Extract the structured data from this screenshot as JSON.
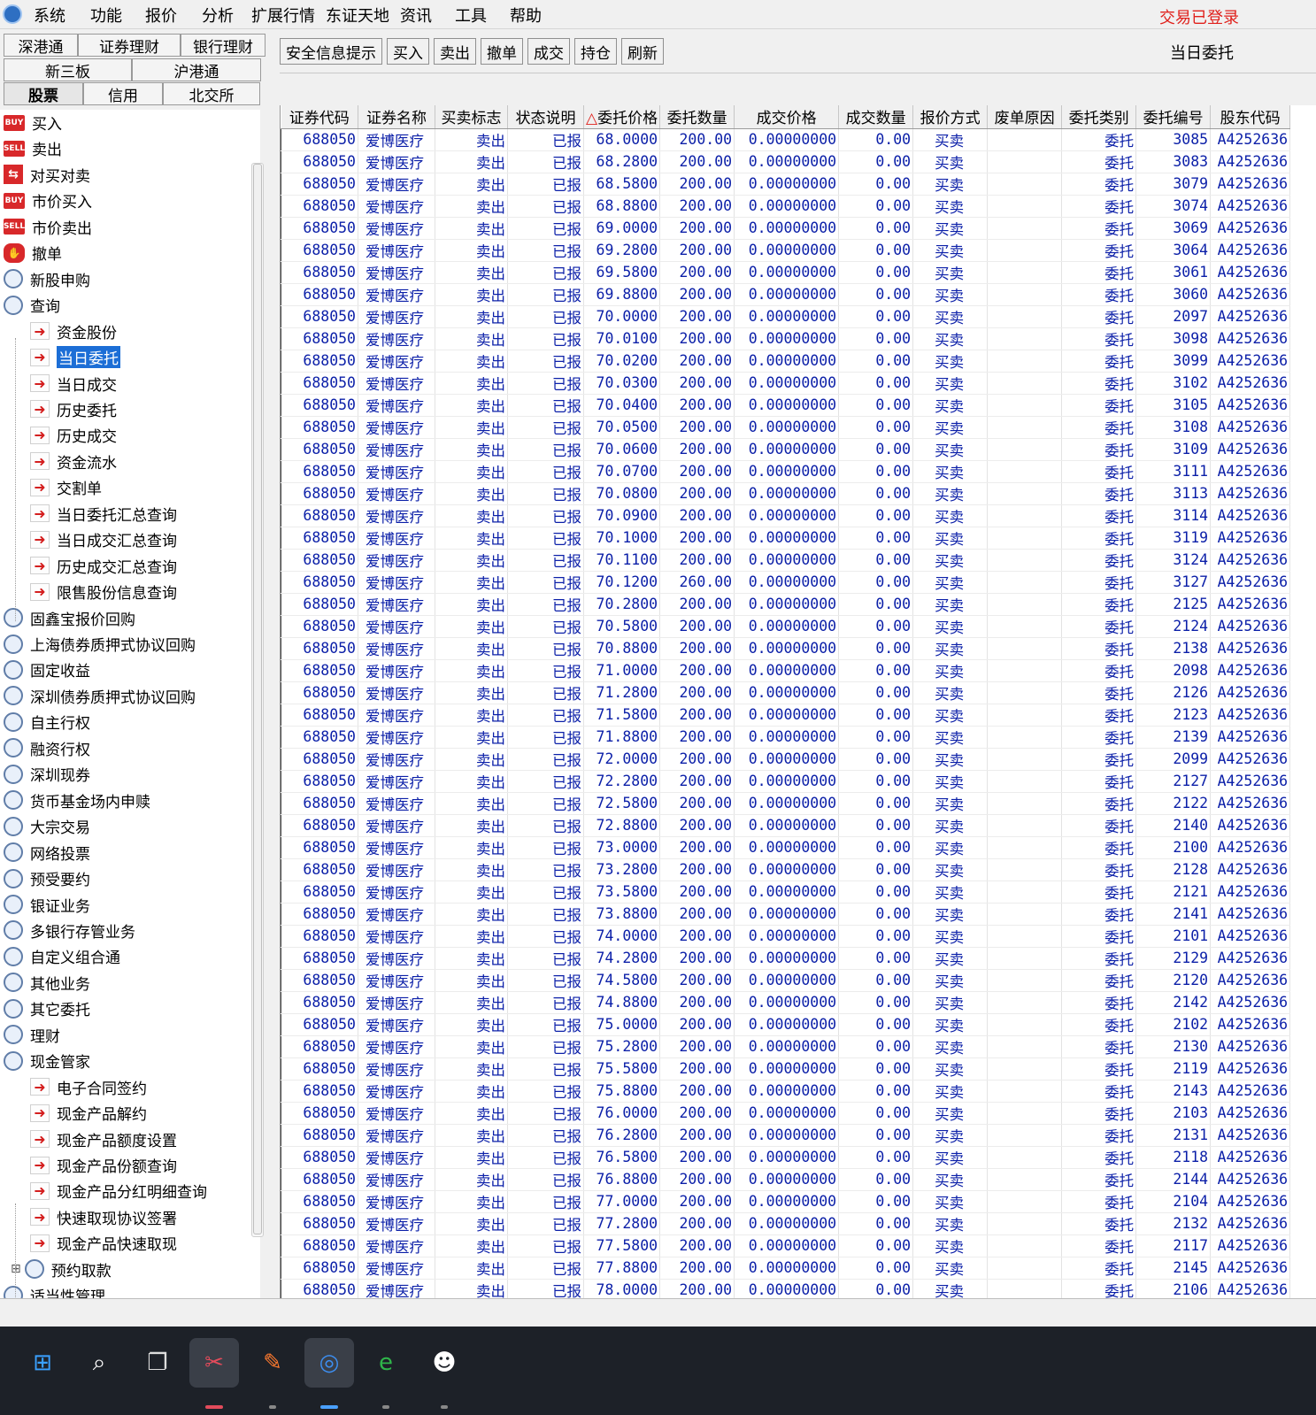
{
  "menubar": {
    "items": [
      "系统",
      "功能",
      "报价",
      "分析",
      "扩展行情",
      "东证天地",
      "资讯",
      "工具",
      "帮助"
    ],
    "login_status": "交易已登录"
  },
  "tabs": {
    "row1": [
      "深港通",
      "证券理财",
      "银行理财"
    ],
    "row2": [
      "新三板",
      "沪港通"
    ],
    "row3": [
      "股票",
      "信用",
      "北交所"
    ]
  },
  "tree": {
    "items": [
      {
        "label": "买入",
        "icon": "buy-icon",
        "level": 0
      },
      {
        "label": "卖出",
        "icon": "sell-icon",
        "level": 0
      },
      {
        "label": "对买对卖",
        "icon": "swap-icon",
        "level": 0
      },
      {
        "label": "市价买入",
        "icon": "buy-icon",
        "level": 0
      },
      {
        "label": "市价卖出",
        "icon": "sell-icon",
        "level": 0
      },
      {
        "label": "撤单",
        "icon": "hand-icon",
        "level": 0
      },
      {
        "label": "新股申购",
        "icon": "magnifier-icon",
        "level": 0
      },
      {
        "label": "查询",
        "icon": "magnifier-icon",
        "level": 0
      },
      {
        "label": "资金股份",
        "icon": "arrow-icon",
        "level": 1
      },
      {
        "label": "当日委托",
        "icon": "arrow-icon",
        "level": 1,
        "selected": true
      },
      {
        "label": "当日成交",
        "icon": "arrow-icon",
        "level": 1
      },
      {
        "label": "历史委托",
        "icon": "arrow-icon",
        "level": 1
      },
      {
        "label": "历史成交",
        "icon": "arrow-icon",
        "level": 1
      },
      {
        "label": "资金流水",
        "icon": "arrow-icon",
        "level": 1
      },
      {
        "label": "交割单",
        "icon": "arrow-icon",
        "level": 1
      },
      {
        "label": "当日委托汇总查询",
        "icon": "arrow-icon",
        "level": 1
      },
      {
        "label": "当日成交汇总查询",
        "icon": "arrow-icon",
        "level": 1
      },
      {
        "label": "历史成交汇总查询",
        "icon": "arrow-icon",
        "level": 1
      },
      {
        "label": "限售股份信息查询",
        "icon": "arrow-icon",
        "level": 1
      },
      {
        "label": "固鑫宝报价回购",
        "icon": "magnifier-icon",
        "level": 0
      },
      {
        "label": "上海债券质押式协议回购",
        "icon": "magnifier-icon",
        "level": 0
      },
      {
        "label": "固定收益",
        "icon": "magnifier-icon",
        "level": 0
      },
      {
        "label": "深圳债券质押式协议回购",
        "icon": "magnifier-icon",
        "level": 0
      },
      {
        "label": "自主行权",
        "icon": "magnifier-icon",
        "level": 0
      },
      {
        "label": "融资行权",
        "icon": "magnifier-icon",
        "level": 0
      },
      {
        "label": "深圳现券",
        "icon": "magnifier-icon",
        "level": 0
      },
      {
        "label": "货币基金场内申赎",
        "icon": "magnifier-icon",
        "level": 0
      },
      {
        "label": "大宗交易",
        "icon": "magnifier-icon",
        "level": 0
      },
      {
        "label": "网络投票",
        "icon": "magnifier-icon",
        "level": 0
      },
      {
        "label": "预受要约",
        "icon": "magnifier-icon",
        "level": 0
      },
      {
        "label": "银证业务",
        "icon": "magnifier-icon",
        "level": 0
      },
      {
        "label": "多银行存管业务",
        "icon": "magnifier-icon",
        "level": 0
      },
      {
        "label": "自定义组合通",
        "icon": "magnifier-icon",
        "level": 0
      },
      {
        "label": "其他业务",
        "icon": "magnifier-icon",
        "level": 0
      },
      {
        "label": "其它委托",
        "icon": "magnifier-icon",
        "level": 0
      },
      {
        "label": "理财",
        "icon": "magnifier-icon",
        "level": 0
      },
      {
        "label": "现金管家",
        "icon": "magnifier-icon",
        "level": 0
      },
      {
        "label": "电子合同签约",
        "icon": "arrow-icon",
        "level": 1
      },
      {
        "label": "现金产品解约",
        "icon": "arrow-icon",
        "level": 1
      },
      {
        "label": "现金产品额度设置",
        "icon": "arrow-icon",
        "level": 1
      },
      {
        "label": "现金产品份额查询",
        "icon": "arrow-icon",
        "level": 1
      },
      {
        "label": "现金产品分红明细查询",
        "icon": "arrow-icon",
        "level": 1
      },
      {
        "label": "快速取现协议签署",
        "icon": "arrow-icon",
        "level": 1
      },
      {
        "label": "现金产品快速取现",
        "icon": "arrow-icon",
        "level": 1
      },
      {
        "label": "预约取款",
        "icon": "magnifier-icon",
        "level": 1,
        "expander": "⊞"
      },
      {
        "label": "适当性管理",
        "icon": "magnifier-icon",
        "level": 0
      }
    ]
  },
  "toolbar": {
    "buttons": [
      "安全信息提示",
      "买入",
      "卖出",
      "撤单",
      "成交",
      "持仓",
      "刷新"
    ],
    "view_title": "当日委托"
  },
  "table": {
    "columns": [
      "证券代码",
      "证券名称",
      "买卖标志",
      "状态说明",
      "委托价格",
      "委托数量",
      "成交价格",
      "成交数量",
      "报价方式",
      "废单原因",
      "委托类别",
      "委托编号",
      "股东代码"
    ],
    "sort_marker": "△",
    "constants": {
      "code": "688050",
      "name": "爱博医疗",
      "side": "卖出",
      "status": "已报",
      "deal_price": "0.00000000",
      "deal_qty": "0.00",
      "quote_mode": "买卖",
      "reject_reason": "",
      "order_type": "委托",
      "holder": "A4252636"
    },
    "rows": [
      {
        "price": "68.0000",
        "qty": "200.00",
        "no": "3085"
      },
      {
        "price": "68.2800",
        "qty": "200.00",
        "no": "3083"
      },
      {
        "price": "68.5800",
        "qty": "200.00",
        "no": "3079"
      },
      {
        "price": "68.8800",
        "qty": "200.00",
        "no": "3074"
      },
      {
        "price": "69.0000",
        "qty": "200.00",
        "no": "3069"
      },
      {
        "price": "69.2800",
        "qty": "200.00",
        "no": "3064"
      },
      {
        "price": "69.5800",
        "qty": "200.00",
        "no": "3061"
      },
      {
        "price": "69.8800",
        "qty": "200.00",
        "no": "3060"
      },
      {
        "price": "70.0000",
        "qty": "200.00",
        "no": "2097"
      },
      {
        "price": "70.0100",
        "qty": "200.00",
        "no": "3098"
      },
      {
        "price": "70.0200",
        "qty": "200.00",
        "no": "3099"
      },
      {
        "price": "70.0300",
        "qty": "200.00",
        "no": "3102"
      },
      {
        "price": "70.0400",
        "qty": "200.00",
        "no": "3105"
      },
      {
        "price": "70.0500",
        "qty": "200.00",
        "no": "3108"
      },
      {
        "price": "70.0600",
        "qty": "200.00",
        "no": "3109"
      },
      {
        "price": "70.0700",
        "qty": "200.00",
        "no": "3111"
      },
      {
        "price": "70.0800",
        "qty": "200.00",
        "no": "3113"
      },
      {
        "price": "70.0900",
        "qty": "200.00",
        "no": "3114"
      },
      {
        "price": "70.1000",
        "qty": "200.00",
        "no": "3119"
      },
      {
        "price": "70.1100",
        "qty": "200.00",
        "no": "3124"
      },
      {
        "price": "70.1200",
        "qty": "260.00",
        "no": "3127"
      },
      {
        "price": "70.2800",
        "qty": "200.00",
        "no": "2125"
      },
      {
        "price": "70.5800",
        "qty": "200.00",
        "no": "2124"
      },
      {
        "price": "70.8800",
        "qty": "200.00",
        "no": "2138"
      },
      {
        "price": "71.0000",
        "qty": "200.00",
        "no": "2098"
      },
      {
        "price": "71.2800",
        "qty": "200.00",
        "no": "2126"
      },
      {
        "price": "71.5800",
        "qty": "200.00",
        "no": "2123"
      },
      {
        "price": "71.8800",
        "qty": "200.00",
        "no": "2139"
      },
      {
        "price": "72.0000",
        "qty": "200.00",
        "no": "2099"
      },
      {
        "price": "72.2800",
        "qty": "200.00",
        "no": "2127"
      },
      {
        "price": "72.5800",
        "qty": "200.00",
        "no": "2122"
      },
      {
        "price": "72.8800",
        "qty": "200.00",
        "no": "2140"
      },
      {
        "price": "73.0000",
        "qty": "200.00",
        "no": "2100"
      },
      {
        "price": "73.2800",
        "qty": "200.00",
        "no": "2128"
      },
      {
        "price": "73.5800",
        "qty": "200.00",
        "no": "2121"
      },
      {
        "price": "73.8800",
        "qty": "200.00",
        "no": "2141"
      },
      {
        "price": "74.0000",
        "qty": "200.00",
        "no": "2101"
      },
      {
        "price": "74.2800",
        "qty": "200.00",
        "no": "2129"
      },
      {
        "price": "74.5800",
        "qty": "200.00",
        "no": "2120"
      },
      {
        "price": "74.8800",
        "qty": "200.00",
        "no": "2142"
      },
      {
        "price": "75.0000",
        "qty": "200.00",
        "no": "2102"
      },
      {
        "price": "75.2800",
        "qty": "200.00",
        "no": "2130"
      },
      {
        "price": "75.5800",
        "qty": "200.00",
        "no": "2119"
      },
      {
        "price": "75.8800",
        "qty": "200.00",
        "no": "2143"
      },
      {
        "price": "76.0000",
        "qty": "200.00",
        "no": "2103"
      },
      {
        "price": "76.2800",
        "qty": "200.00",
        "no": "2131"
      },
      {
        "price": "76.5800",
        "qty": "200.00",
        "no": "2118"
      },
      {
        "price": "76.8800",
        "qty": "200.00",
        "no": "2144"
      },
      {
        "price": "77.0000",
        "qty": "200.00",
        "no": "2104"
      },
      {
        "price": "77.2800",
        "qty": "200.00",
        "no": "2132"
      },
      {
        "price": "77.5800",
        "qty": "200.00",
        "no": "2117"
      },
      {
        "price": "77.8800",
        "qty": "200.00",
        "no": "2145"
      },
      {
        "price": "78.0000",
        "qty": "200.00",
        "no": "2106"
      }
    ]
  },
  "taskbar": {
    "icons": [
      "windows-start-icon",
      "search-icon",
      "task-view-icon",
      "snipping-tool-icon",
      "feather-app-icon",
      "trading-app-icon",
      "browser-icon",
      "qq-icon"
    ]
  },
  "colors": {
    "cell_text": "#0b1fa8",
    "login_status": "#e0201b",
    "selection": "#1c6ed6",
    "taskbar": "#1d2128"
  }
}
